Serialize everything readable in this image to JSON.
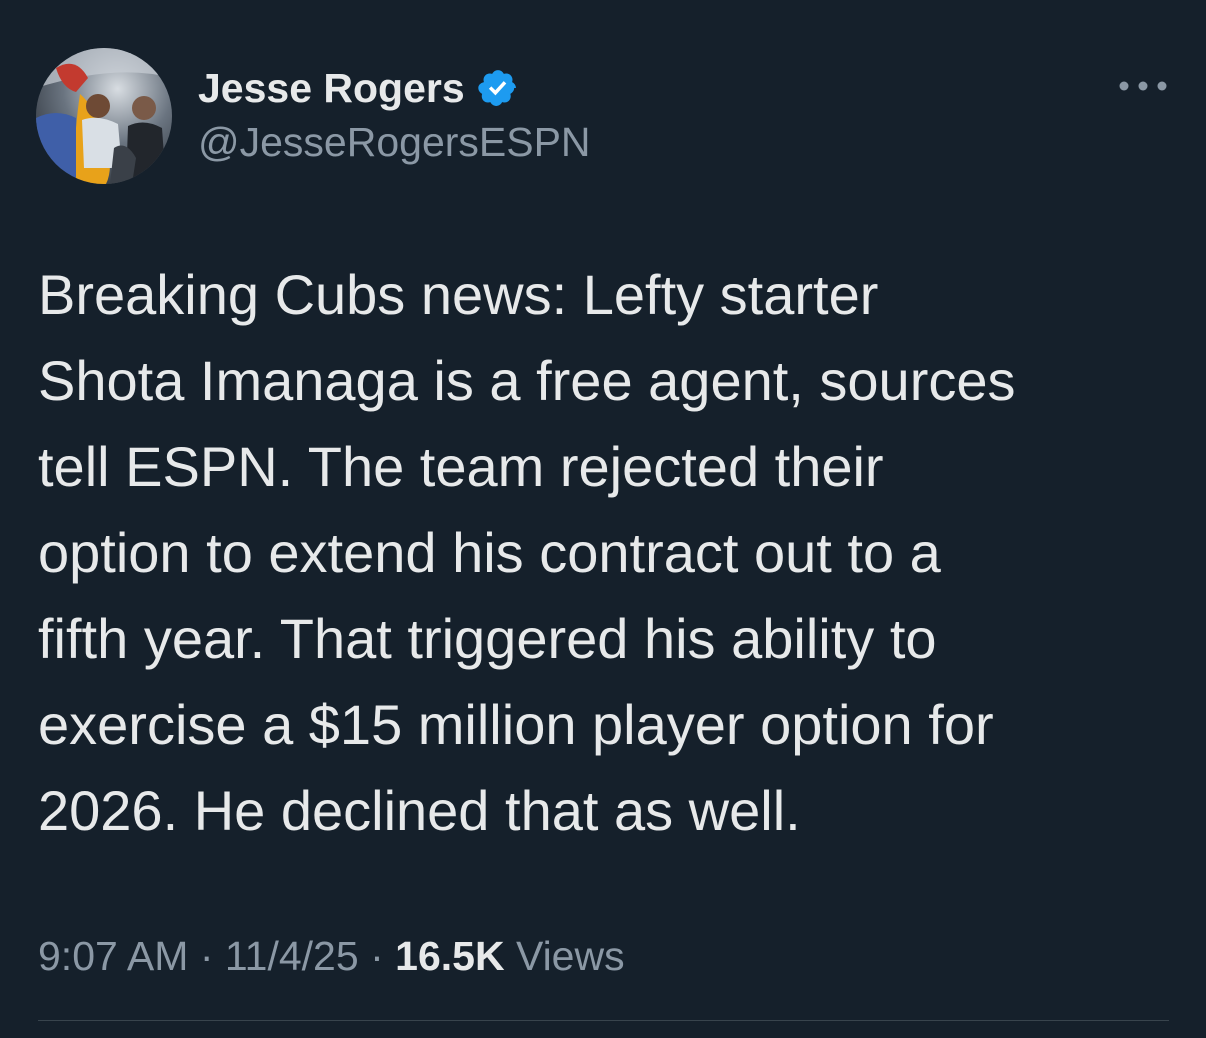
{
  "author": {
    "display_name": "Jesse Rogers",
    "handle": "@JesseRogersESPN",
    "verified": true,
    "verified_color": "#1d9bf0"
  },
  "tweet": {
    "text": "Breaking Cubs news: Lefty starter\nShota Imanaga is a free agent, sources\ntell ESPN. The team rejected their\noption to extend his contract out to a\nfifth year. That triggered his ability to\nexercise a $15 million player option for\n2026. He declined that as well.",
    "time": "9:07 AM",
    "separator": "·",
    "date": "11/4/25",
    "views_count": "16.5K",
    "views_label": "Views"
  },
  "icons": {
    "avatar": "avatar-photo",
    "verified": "verified-badge-icon",
    "more": "more-options-icon"
  },
  "colors": {
    "background": "#15202b",
    "text_primary": "#e7e9ea",
    "text_secondary": "#8b98a5",
    "divider": "#38444d"
  }
}
